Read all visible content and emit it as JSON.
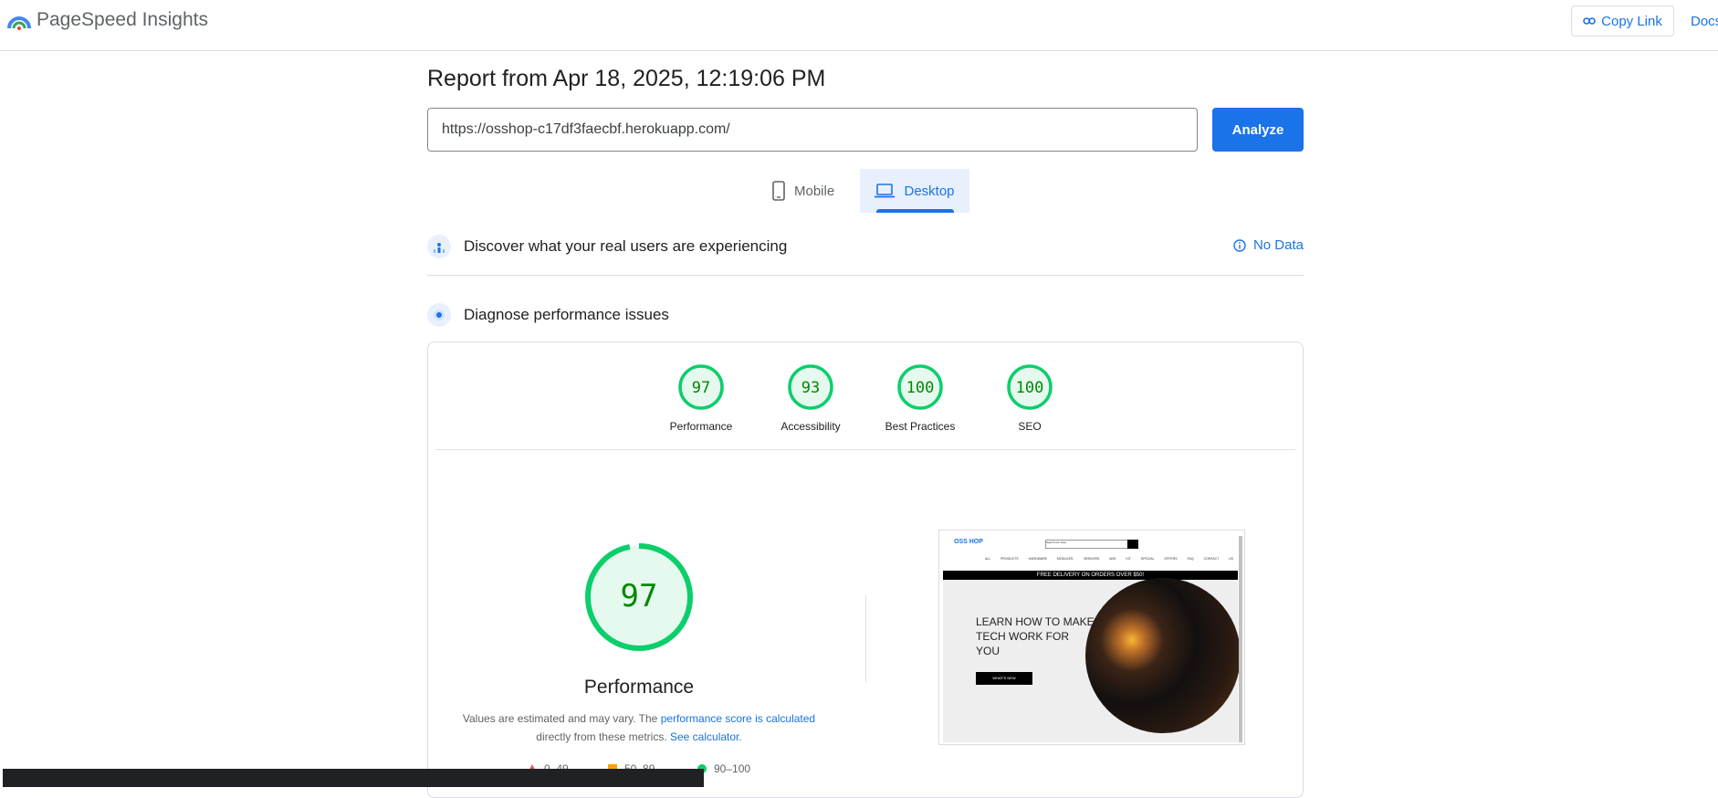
{
  "header": {
    "brand": "PageSpeed Insights",
    "copy_link": "Copy Link",
    "docs": "Docs"
  },
  "report": {
    "title": "Report from Apr 18, 2025, 12:19:06 PM",
    "url": "https://osshop-c17df3faecbf.herokuapp.com/",
    "analyze": "Analyze"
  },
  "tabs": {
    "mobile": "Mobile",
    "desktop": "Desktop",
    "selected": "Desktop"
  },
  "field_data": {
    "title": "Discover what your real users are experiencing",
    "status": "No Data"
  },
  "diagnose": {
    "title": "Diagnose performance issues"
  },
  "scores": [
    {
      "label": "Performance",
      "value": "97"
    },
    {
      "label": "Accessibility",
      "value": "93"
    },
    {
      "label": "Best Practices",
      "value": "100"
    },
    {
      "label": "SEO",
      "value": "100"
    }
  ],
  "performance": {
    "score": "97",
    "title": "Performance",
    "desc_1": "Values are estimated and may vary. The",
    "link_1": "performance score is calculated",
    "desc_2": "directly from these metrics.",
    "link_2": "See calculator.",
    "legend": [
      "0–49",
      "50–89",
      "90–100"
    ]
  },
  "thumbnail": {
    "logo": "OSS HOP",
    "search_placeholder": "Search our store",
    "nav": "ALL PRODUCTS HARDWARE MODULES, SENSORS AND KIT SPECIAL OFFERS FAQ CONTACT US",
    "banner": "FREE DELIVERY ON ORDERS OVER $50!",
    "hero_text": "LEARN HOW TO MAKE TECH WORK FOR YOU",
    "hero_button": "WHAT'S NEW"
  },
  "colors": {
    "accent": "#1a73e8",
    "pass": "#0cce6b",
    "pass_fill": "#e6f9ee",
    "pass_text": "#008800",
    "average": "#ffa400",
    "fail": "#ff4e42"
  }
}
